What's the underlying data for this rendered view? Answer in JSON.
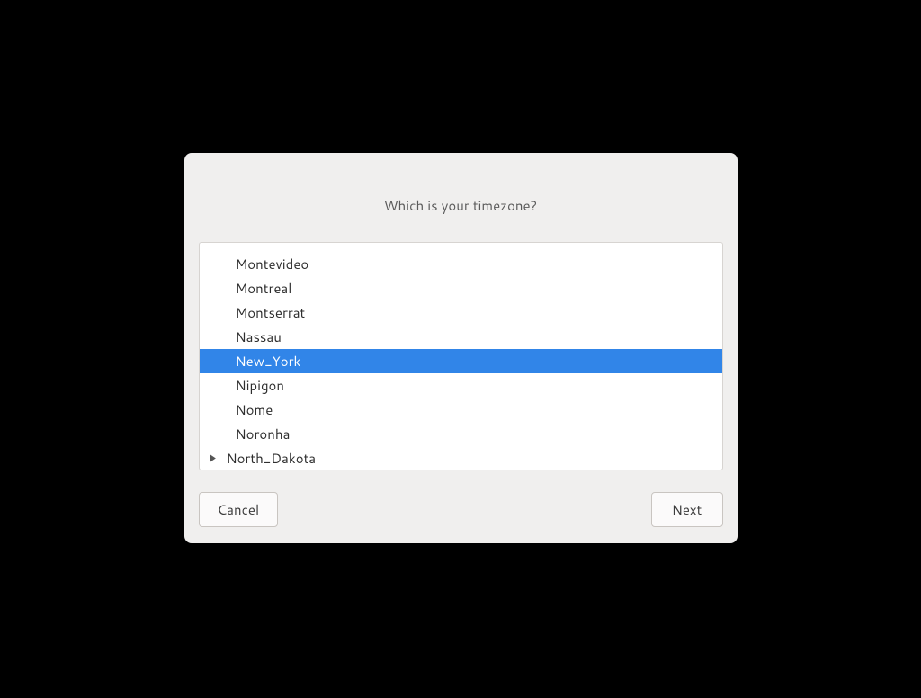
{
  "dialog": {
    "title": "Which is your timezone?",
    "buttons": {
      "cancel": "Cancel",
      "next": "Next"
    }
  },
  "timezone_list": {
    "visible_items": [
      {
        "label": "",
        "expandable": false,
        "selected": false
      },
      {
        "label": "Montevideo",
        "expandable": false,
        "selected": false
      },
      {
        "label": "Montreal",
        "expandable": false,
        "selected": false
      },
      {
        "label": "Montserrat",
        "expandable": false,
        "selected": false
      },
      {
        "label": "Nassau",
        "expandable": false,
        "selected": false
      },
      {
        "label": "New_York",
        "expandable": false,
        "selected": true
      },
      {
        "label": "Nipigon",
        "expandable": false,
        "selected": false
      },
      {
        "label": "Nome",
        "expandable": false,
        "selected": false
      },
      {
        "label": "Noronha",
        "expandable": false,
        "selected": false
      },
      {
        "label": "North_Dakota",
        "expandable": true,
        "selected": false
      }
    ],
    "selected": "New_York"
  },
  "colors": {
    "selection": "#3185e8",
    "dialog_bg": "#f0efee",
    "border": "#d7d4d1"
  }
}
